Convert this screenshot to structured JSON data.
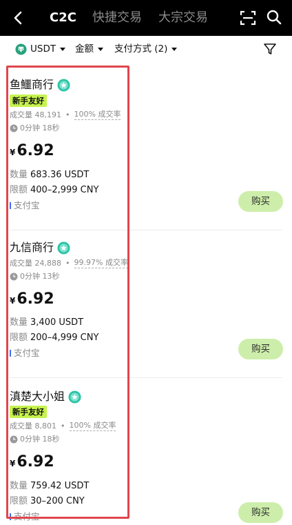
{
  "header": {
    "tabs": [
      {
        "label": "C2C",
        "active": true
      },
      {
        "label": "快捷交易",
        "active": false
      },
      {
        "label": "大宗交易",
        "active": false
      }
    ]
  },
  "filters": {
    "coin": "USDT",
    "amount": "金额",
    "payment": "支付方式 (2)"
  },
  "colors": {
    "accent_badge": "#c6f24e",
    "buy_button": "#cdeeaa",
    "highlight_border": "#e0454d",
    "verified_badge": "#2bc4a5"
  },
  "ads": [
    {
      "merchant": "鱼鱷商行",
      "badge": "新手友好",
      "volume": "成交量 48,191",
      "completion": "100% 成交率",
      "time": "0分钟 18秒",
      "currency": "¥",
      "price": "6.92",
      "qty_label": "数量",
      "qty": "683.36 USDT",
      "limit_label": "限额",
      "limit": "400–2,999 CNY",
      "payment": "支付宝",
      "buy": "购买"
    },
    {
      "merchant": "九信商行",
      "badge": "",
      "volume": "成交量 24,888",
      "completion": "99.97% 成交率",
      "time": "0分钟 13秒",
      "currency": "¥",
      "price": "6.92",
      "qty_label": "数量",
      "qty": "3,400 USDT",
      "limit_label": "限额",
      "limit": "200–4,999 CNY",
      "payment": "支付宝",
      "buy": "购买"
    },
    {
      "merchant": "滇楚大小姐",
      "badge": "新手友好",
      "volume": "成交量 8,801",
      "completion": "100% 成交率",
      "time": "0分钟 18秒",
      "currency": "¥",
      "price": "6.92",
      "qty_label": "数量",
      "qty": "759.42 USDT",
      "limit_label": "限额",
      "limit": "30–200 CNY",
      "payment": "支付宝",
      "buy": "购买"
    }
  ]
}
